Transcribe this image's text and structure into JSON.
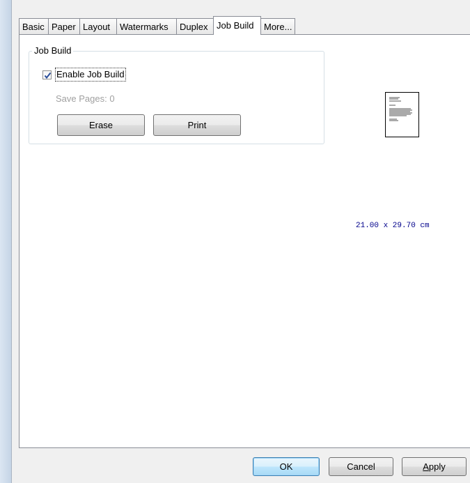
{
  "tabs": [
    "Basic",
    "Paper",
    "Layout",
    "Watermarks",
    "Duplex",
    "Job Build",
    "More..."
  ],
  "active_tab": "Job Build",
  "job_build": {
    "group_title": "Job Build",
    "enable_label": "Enable Job Build",
    "enable_checked": true,
    "save_pages_text": "Save Pages: 0",
    "erase_label": "Erase",
    "print_label": "Print"
  },
  "preview": {
    "paper_size": "21.00 x 29.70 cm"
  },
  "buttons": {
    "ok": "OK",
    "cancel": "Cancel",
    "apply_mnemonic": "A",
    "apply_rest": "pply"
  }
}
